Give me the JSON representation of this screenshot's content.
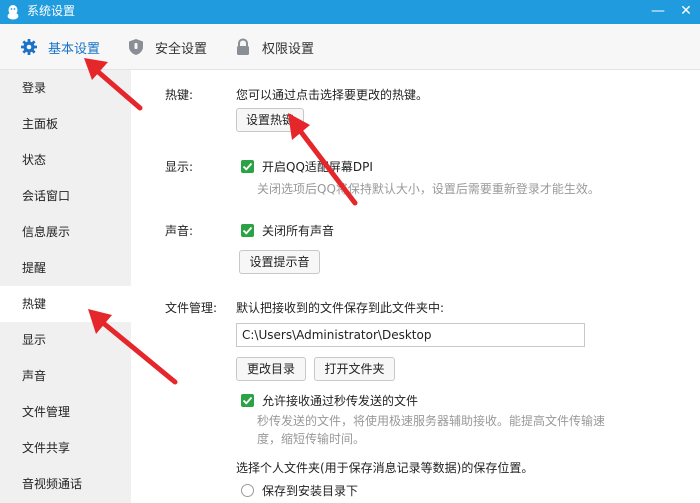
{
  "window": {
    "title": "系统设置",
    "minimize_glyph": "—",
    "close_glyph": "✕",
    "app_icon": "penguin-icon"
  },
  "tabs": [
    {
      "label": "基本设置",
      "icon": "gear-icon",
      "active": true
    },
    {
      "label": "安全设置",
      "icon": "shield-icon",
      "active": false
    },
    {
      "label": "权限设置",
      "icon": "lock-icon",
      "active": false
    }
  ],
  "sidebar": {
    "items": [
      {
        "label": "登录"
      },
      {
        "label": "主面板"
      },
      {
        "label": "状态"
      },
      {
        "label": "会话窗口"
      },
      {
        "label": "信息展示"
      },
      {
        "label": "提醒"
      },
      {
        "label": "热键",
        "active": true
      },
      {
        "label": "显示"
      },
      {
        "label": "声音"
      },
      {
        "label": "文件管理"
      },
      {
        "label": "文件共享"
      },
      {
        "label": "音视频通话"
      }
    ]
  },
  "hotkey": {
    "label": "热键:",
    "description": "您可以通过点击选择要更改的热键。",
    "button": "设置热键"
  },
  "display": {
    "label": "显示:",
    "checkbox_label": "开启QQ适配屏幕DPI",
    "checked": true,
    "hint": "关闭选项后QQ将保持默认大小，设置后需要重新登录才能生效。"
  },
  "sound": {
    "label": "声音:",
    "checkbox_label": "关闭所有声音",
    "checked": true,
    "button": "设置提示音"
  },
  "file_management": {
    "label": "文件管理:",
    "description": "默认把接收到的文件保存到此文件夹中:",
    "path_value": "C:\\Users\\Administrator\\Desktop",
    "change_button": "更改目录",
    "open_button": "打开文件夹",
    "fast_transfer_label": "允许接收通过秒传发送的文件",
    "fast_transfer_checked": true,
    "fast_transfer_hint_line1": "秒传发送的文件，将使用极速服务器辅助接收。能提高文件传输速",
    "fast_transfer_hint_line2": "度，缩短传输时间。",
    "personal_folder_label": "选择个人文件夹(用于保存消息记录等数据)的保存位置。",
    "radio_install_dir": "保存到安装目录下"
  },
  "colors": {
    "titlebar": "#1f9bde",
    "accent": "#1a73c8",
    "checkbox": "#2ba245",
    "annotation_arrow": "#e5262b"
  }
}
